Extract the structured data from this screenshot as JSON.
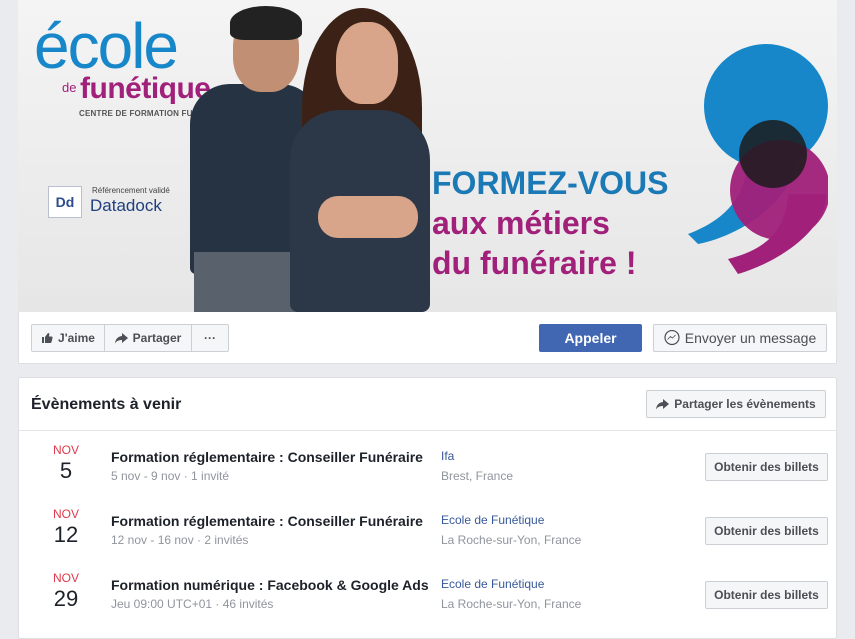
{
  "cover": {
    "logo_ecole": "école",
    "logo_de": "de",
    "logo_funetique": "funétique",
    "logo_centre": "CENTRE DE FORMATION FUNÉRAIRE",
    "datadock_ref": "Référencement validé",
    "datadock_name": "Datadock",
    "datadock_badge": "Dd",
    "headline_1": "FORMEZ-VOUS",
    "headline_2": "aux métiers",
    "headline_3": "du funéraire !",
    "colors": {
      "blue": "#1787c9",
      "magenta": "#a0207a",
      "black": "#1b1b1b"
    }
  },
  "actions": {
    "like_label": "J'aime",
    "share_label": "Partager",
    "more_label": "···",
    "call_label": "Appeler",
    "message_label": "Envoyer un message",
    "icons": [
      "thumbs-up-icon",
      "share-arrow-icon",
      "more-dots-icon",
      "messenger-icon"
    ]
  },
  "events": {
    "title": "Évènements à venir",
    "share_label": "Partager les évènements",
    "items": [
      {
        "month": "NOV",
        "day": "5",
        "title": "Formation réglementaire : Conseiller Funéraire",
        "meta": "5 nov - 9 nov · 1 invité",
        "place": "Ifa",
        "city": "Brest, France",
        "ticket_label": "Obtenir des billets"
      },
      {
        "month": "NOV",
        "day": "12",
        "title": "Formation réglementaire : Conseiller Funéraire",
        "meta": "12 nov - 16 nov · 2 invités",
        "place": "Ecole de Funétique",
        "city": "La Roche-sur-Yon, France",
        "ticket_label": "Obtenir des billets"
      },
      {
        "month": "NOV",
        "day": "29",
        "title": "Formation numérique : Facebook & Google Ads",
        "meta": "Jeu 09:00 UTC+01 · 46 invités",
        "place": "Ecole de Funétique",
        "city": "La Roche-sur-Yon, France",
        "ticket_label": "Obtenir des billets"
      }
    ]
  }
}
